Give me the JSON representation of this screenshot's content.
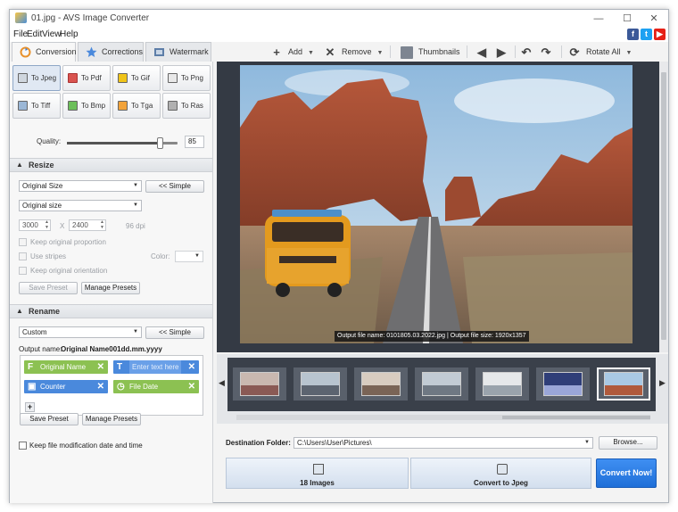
{
  "app": {
    "title": "01.jpg - AVS Image Converter"
  },
  "window_controls": {
    "minimize": "—",
    "maximize": "☐",
    "close": "✕"
  },
  "menu": [
    "File",
    "Edit",
    "View",
    "Help"
  ],
  "social": [
    {
      "name": "facebook",
      "glyph": "f",
      "color": "#3b5998"
    },
    {
      "name": "twitter",
      "glyph": "t",
      "color": "#1da1f2"
    },
    {
      "name": "youtube",
      "glyph": "▶",
      "color": "#e62117"
    }
  ],
  "tabs": [
    {
      "label": "Conversion",
      "active": true,
      "icon": "conversion-icon"
    },
    {
      "label": "Corrections",
      "active": false,
      "icon": "star-icon"
    },
    {
      "label": "Watermark",
      "active": false,
      "icon": "watermark-icon"
    }
  ],
  "toolbar": {
    "add": "Add",
    "remove": "Remove",
    "thumbnails": "Thumbnails",
    "rotate_all": "Rotate All"
  },
  "formats": [
    {
      "label": "To Jpeg",
      "selected": true
    },
    {
      "label": "To Pdf",
      "selected": false
    },
    {
      "label": "To Gif",
      "selected": false
    },
    {
      "label": "To Png",
      "selected": false
    },
    {
      "label": "To Tiff",
      "selected": false
    },
    {
      "label": "To Bmp",
      "selected": false
    },
    {
      "label": "To Tga",
      "selected": false
    },
    {
      "label": "To Ras",
      "selected": false
    }
  ],
  "quality": {
    "label": "Quality:",
    "value": "85",
    "level": 0.85
  },
  "resize": {
    "header": "Resize",
    "mode": "Original Size",
    "simple_button": "<< Simple",
    "size_preset": "Original size",
    "width": "3000",
    "x_label": "X",
    "height": "2400",
    "dpi": "96 dpi",
    "keep_proportion": "Keep original proportion",
    "use_stripes": "Use stripes",
    "color_label": "Color:",
    "keep_orientation": "Keep original orientation",
    "save_preset": "Save Preset",
    "manage_presets": "Manage Presets"
  },
  "rename": {
    "header": "Rename",
    "mode": "Custom",
    "simple_button": "<< Simple",
    "output_label": "Output name:",
    "output_value": "Original Name001dd.mm.yyyy",
    "tags": [
      {
        "label": "Original Name",
        "glyph": "F",
        "color": "#8cc152"
      },
      {
        "label": "Enter text here",
        "glyph": "T",
        "color": "#4a89dc"
      },
      {
        "label": "Counter",
        "glyph": "▣",
        "color": "#4a89dc"
      },
      {
        "label": "File Date",
        "glyph": "◷",
        "color": "#8cc152"
      }
    ],
    "add_button": "+",
    "save_preset": "Save Preset",
    "manage_presets": "Manage Presets"
  },
  "keep_date": "Keep file modification date and time",
  "preview": {
    "caption": "Output file name: 0101805.03.2022.jpg | Output file size: 1920x1357"
  },
  "thumbnails": [
    {
      "name": "portrait-couple",
      "sky": "#c9b8b0",
      "ground": "#8a5a55"
    },
    {
      "name": "family-sofa",
      "sky": "#b8c4cf",
      "ground": "#5c6470"
    },
    {
      "name": "family-hug",
      "sky": "#d8ccc0",
      "ground": "#7a6456"
    },
    {
      "name": "family-portrait",
      "sky": "#c2cbd4",
      "ground": "#6f7883"
    },
    {
      "name": "woman-standing",
      "sky": "#e6e8ea",
      "ground": "#9aa3ac"
    },
    {
      "name": "tree-night",
      "sky": "#2f3e78",
      "ground": "#9aa6d8"
    },
    {
      "name": "desert-van",
      "sky": "#a9c9e4",
      "ground": "#b05a3c"
    }
  ],
  "destination": {
    "label": "Destination Folder:",
    "path": "C:\\Users\\User\\Pictures\\",
    "browse": "Browse..."
  },
  "flow": {
    "images": "18 Images",
    "convert_to": "Convert to Jpeg"
  },
  "convert_button": "Convert Now!"
}
